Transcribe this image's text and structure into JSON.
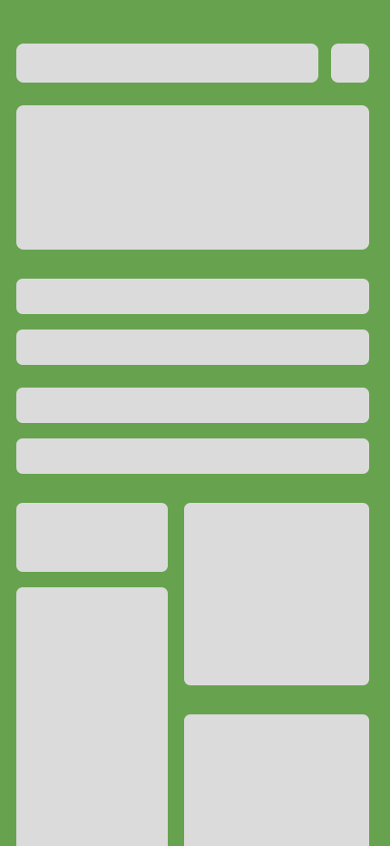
{
  "theme": {
    "background": "#67a34f",
    "placeholder": "#dbdbdb"
  },
  "header": {
    "search_bar": "",
    "corner_button": ""
  },
  "hero": {
    "card": ""
  },
  "list": {
    "rows": [
      "",
      "",
      "",
      ""
    ]
  },
  "grid": {
    "tiles": [
      "",
      "",
      "",
      ""
    ]
  }
}
